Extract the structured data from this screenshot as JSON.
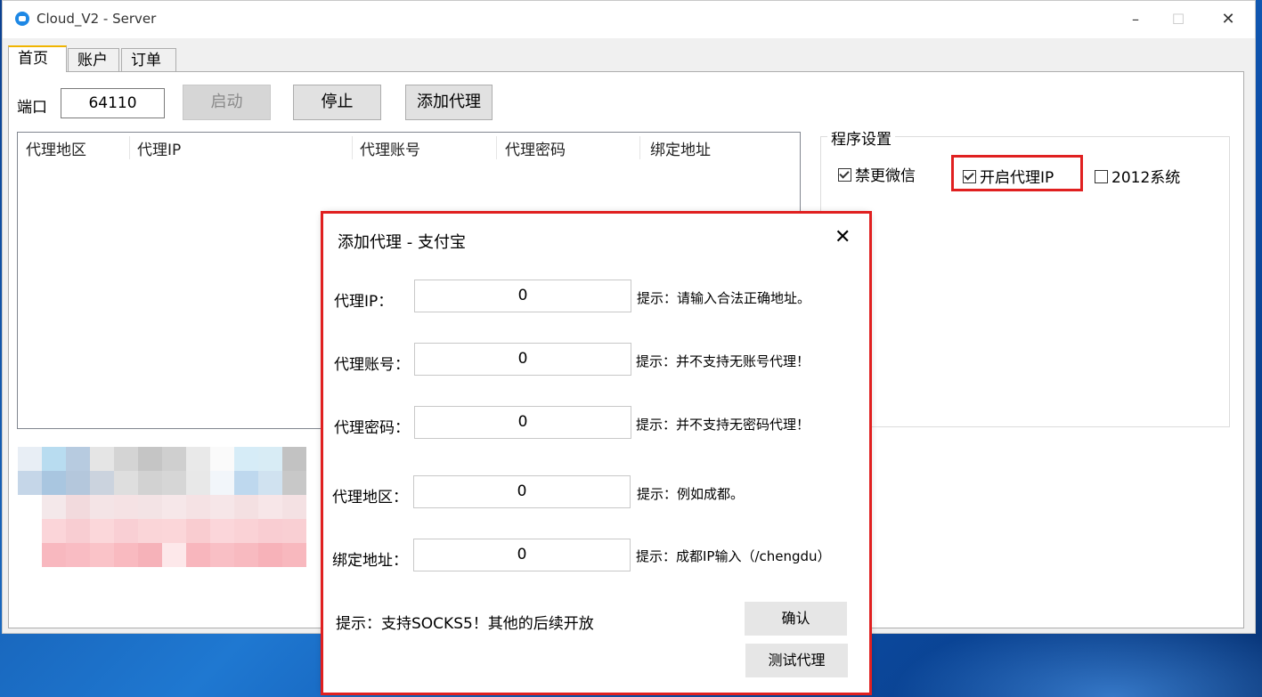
{
  "window": {
    "title": "Cloud_V2 - Server",
    "controls": {
      "minimize": "–",
      "maximize": "☐",
      "close": "✕"
    }
  },
  "tabs": [
    {
      "label": "首页",
      "active": true
    },
    {
      "label": "账户",
      "active": false
    },
    {
      "label": "订单",
      "active": false
    }
  ],
  "home": {
    "port_label": "端口",
    "port_value": "64110",
    "start_label": "启动",
    "stop_label": "停止",
    "add_proxy_label": "添加代理",
    "proxy_table": {
      "columns": [
        "代理地区",
        "代理IP",
        "代理账号",
        "代理密码",
        "绑定地址"
      ],
      "rows": []
    },
    "settings": {
      "title": "程序设置",
      "options": [
        {
          "label": "禁更微信",
          "checked": true
        },
        {
          "label": "开启代理IP",
          "checked": true
        },
        {
          "label": "2012系统",
          "checked": false
        }
      ]
    }
  },
  "dialog": {
    "title": "添加代理 - 支付宝",
    "close": "✕",
    "fields": [
      {
        "label": "代理IP：",
        "value": "0",
        "hint": "提示：请输入合法正确地址。"
      },
      {
        "label": "代理账号：",
        "value": "0",
        "hint": "提示：并不支持无账号代理！"
      },
      {
        "label": "代理密码：",
        "value": "0",
        "hint": "提示：并不支持无密码代理！"
      },
      {
        "label": "代理地区：",
        "value": "0",
        "hint": "提示：例如成都。"
      },
      {
        "label": "绑定地址：",
        "value": "0",
        "hint": "提示：成都IP输入（/chengdu）"
      }
    ],
    "note": "提示：支持SOCKS5！其他的后续开放",
    "confirm_label": "确认",
    "test_label": "测试代理"
  },
  "colors": {
    "highlight": "#e02020",
    "tab_accent": "#f0b400",
    "app_icon": "#1e88e5"
  }
}
